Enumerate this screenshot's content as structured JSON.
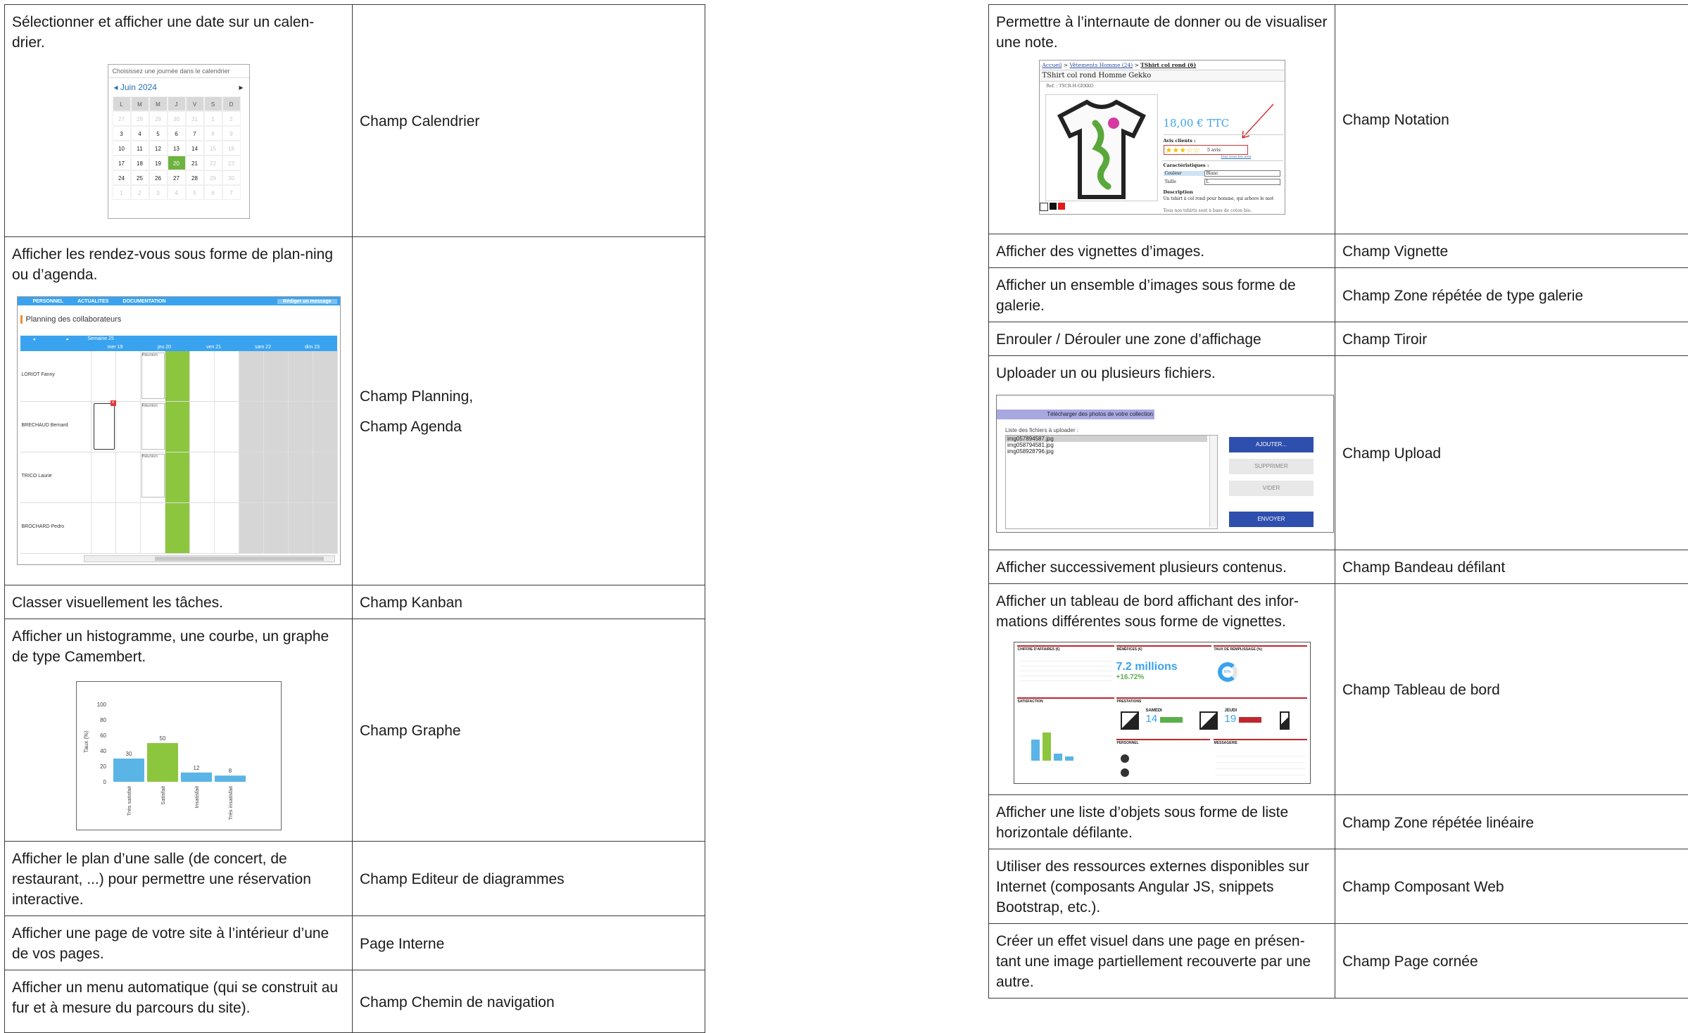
{
  "left_table": [
    {
      "desc": "Sélectionner et afficher une date sur un calen-drier.",
      "field": [
        "Champ Calendrier"
      ]
    },
    {
      "desc": "Afficher les rendez-vous sous forme de plan-ning ou d’agenda.",
      "field": [
        "Champ Planning,",
        "Champ Agenda"
      ]
    },
    {
      "desc": "Classer visuellement les tâches.",
      "field": [
        "Champ Kanban"
      ]
    },
    {
      "desc": "Afficher un histogramme, une courbe, un graphe de type Camembert.",
      "field": [
        "Champ Graphe"
      ]
    },
    {
      "desc": "Afficher le plan d’une salle (de concert, de restaurant, ...) pour permettre une réservation interactive.",
      "field": [
        "Champ Editeur de diagrammes"
      ]
    },
    {
      "desc": "Afficher une page de votre site à l’intérieur d’une de vos pages.",
      "field": [
        "Page Interne"
      ]
    },
    {
      "desc": "Afficher un menu automatique (qui se construit au fur et à mesure du parcours du site).",
      "field": [
        "Champ Chemin de navigation"
      ]
    }
  ],
  "right_table": [
    {
      "desc": "Permettre à l’internaute de donner ou de visualiser une note.",
      "field": "Champ Notation"
    },
    {
      "desc": "Afficher des vignettes d’images.",
      "field": "Champ Vignette"
    },
    {
      "desc": "Afficher un ensemble d’images sous forme de galerie.",
      "field": "Champ Zone répétée de type galerie"
    },
    {
      "desc": "Enrouler / Dérouler une zone d’affichage",
      "field": "Champ Tiroir"
    },
    {
      "desc": "Uploader un ou plusieurs fichiers.",
      "field": "Champ Upload"
    },
    {
      "desc": "Afficher successivement plusieurs contenus.",
      "field": "Champ Bandeau défilant"
    },
    {
      "desc": "Afficher un tableau de bord affichant des infor-mations différentes sous forme de vignettes.",
      "field": "Champ Tableau de bord"
    },
    {
      "desc": "Afficher une liste d’objets sous forme de liste horizontale défilante.",
      "field": "Champ Zone répétée linéaire"
    },
    {
      "desc": "Utiliser des ressources externes disponibles sur Internet (composants Angular JS, snippets Bootstrap, etc.).",
      "field": "Champ Composant Web"
    },
    {
      "desc": "Créer un effet visuel dans une page en présen-tant une image partiellement recouverte par une autre.",
      "field": "Champ Page cornée"
    }
  ],
  "calendar": {
    "header": "Choisissez une journée dans le calendrier",
    "month": "Juin 2024",
    "prev": "◂",
    "next": "▸",
    "days": [
      "L",
      "M",
      "M",
      "J",
      "V",
      "S",
      "D"
    ],
    "weeks": [
      [
        "27",
        "28",
        "29",
        "30",
        "31",
        "1",
        "2"
      ],
      [
        "3",
        "4",
        "5",
        "6",
        "7",
        "8",
        "9"
      ],
      [
        "10",
        "11",
        "12",
        "13",
        "14",
        "15",
        "16"
      ],
      [
        "17",
        "18",
        "19",
        "20",
        "21",
        "22",
        "23"
      ],
      [
        "24",
        "25",
        "26",
        "27",
        "28",
        "29",
        "30"
      ],
      [
        "1",
        "2",
        "3",
        "4",
        "5",
        "6",
        "7"
      ]
    ],
    "selected": "20",
    "accent": "#6db33f"
  },
  "planning": {
    "nav": [
      "PERSONNEL",
      "ACTUALITES",
      "DOCUMENTATION"
    ],
    "nav_button": "Rédiger un message",
    "title": "Planning des collaborateurs",
    "week": "Semaine 25",
    "days": [
      "mer 19",
      "jeu 20",
      "ven 21",
      "sam 22",
      "dim 23"
    ],
    "people": [
      "LORIOT Fanny",
      "BRECHAUD Bernard",
      "TRICO Laurie",
      "BROCHARD Pedro"
    ],
    "event": "Réunion",
    "prev": "◂",
    "next": "▸"
  },
  "graph_chart": {
    "chart_data": {
      "type": "bar",
      "categories": [
        "Très satisfait",
        "Satisfait",
        "Insatisfait",
        "Très insatisfait"
      ],
      "values": [
        30,
        50,
        12,
        8
      ],
      "ylabel": "Taux (%)",
      "ylim": [
        0,
        100
      ],
      "yticks": [
        "0",
        "20",
        "40",
        "60",
        "80",
        "100"
      ],
      "colors": [
        "#5ab4e5",
        "#8cc63f",
        "#5ab4e5",
        "#5ab4e5"
      ]
    }
  },
  "product": {
    "breadcrumb_home": "Accueil",
    "breadcrumb_sep": " > ",
    "breadcrumb_cat": "Vêtements Homme (24)",
    "breadcrumb_item": "TShirt col rond (6)",
    "title": "TShirt col rond Homme Gekko",
    "ref": "Ref. : TSCR-H-GEKKO",
    "price": "18,00 € TTC",
    "reviews_label": "Avis clients :",
    "stars": "★★★☆☆",
    "reviews_count": "5 avis",
    "see_all": "Voir tous les avis",
    "features_label": "Caractéristiques :",
    "color_label": "Couleur",
    "color_value": "Blanc",
    "size_label": "Taille",
    "size_value": "L",
    "description_label": "Description",
    "description_text": "Un tshirt à col rond pour homme, qui arbore le mot",
    "description_more": "Tous nos tshirts sont à base de coton bio."
  },
  "upload": {
    "title": "Télécharger des photos de votre collection",
    "list_label": "Liste des fichiers à uploader :",
    "files": [
      "img057894587.jpg",
      "img058794581.jpg",
      "img058928796.jpg"
    ],
    "buttons": [
      "AJOUTER...",
      "SUPPRIMER",
      "VIDER",
      "ENVOYER"
    ]
  },
  "dashboard": {
    "panels": [
      "CHIFFRE D'AFFAIRES (€)",
      "BÉNÉFICES (€)",
      "TAUX DE REMPLISSAGE (%)",
      "SATISFACTION",
      "PRESTATIONS",
      "PERSONNEL",
      "MESSAGERIE"
    ],
    "big_value": "7.2 millions",
    "delta": "+16.72%",
    "gauge": "60%",
    "day1": "SAMEDI",
    "day1_num": "14",
    "day2": "JEUDI",
    "day2_num": "19"
  }
}
